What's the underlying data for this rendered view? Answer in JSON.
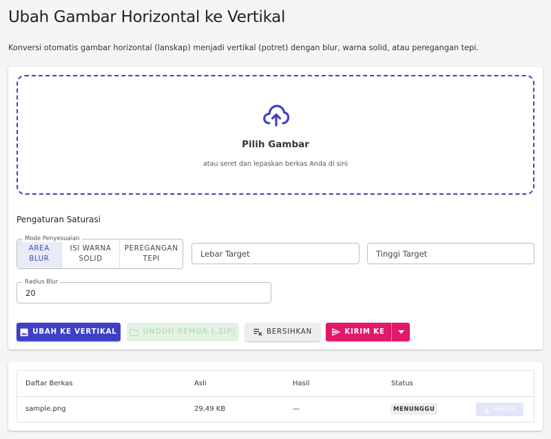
{
  "header": {
    "title": "Ubah Gambar Horizontal ke Vertikal",
    "description": "Konversi otomatis gambar horizontal (lanskap) menjadi vertikal (potret) dengan blur, warna solid, atau peregangan tepi."
  },
  "dropzone": {
    "icon": "cloud-upload-icon",
    "title": "Pilih Gambar",
    "subtitle": "atau seret dan lepaskan berkas Anda di sini"
  },
  "settings": {
    "title": "Pengaturan Saturasi",
    "mode_legend": "Mode Penyesuaian",
    "modes": [
      {
        "label": "AREA\nBLUR",
        "selected": true
      },
      {
        "label": "ISI WARNA\nSOLID",
        "selected": false
      },
      {
        "label": "PEREGANGAN\nTEPI",
        "selected": false
      }
    ],
    "target_width_placeholder": "Lebar Target",
    "target_height_placeholder": "Tinggi Target",
    "blur_radius_legend": "Radius Blur",
    "blur_radius_value": "20"
  },
  "actions": {
    "convert_label": "UBAH KE VERTIKAL",
    "download_all_label": "UNDUH SEMUA (.ZIP)",
    "clear_label": "BERSIHKAN",
    "send_label": "KIRIM KE"
  },
  "files": {
    "columns": [
      "Daftar Berkas",
      "Asli",
      "Hasil",
      "Status"
    ],
    "rows": [
      {
        "name": "sample.png",
        "original": "29,49 KB",
        "result": "—",
        "status": "MENUNGGU",
        "download_label": "UNDUH"
      }
    ]
  },
  "colors": {
    "primary": "#3f3fc8",
    "accent": "#e0196b",
    "success_disabled": "#e3f2e5"
  }
}
